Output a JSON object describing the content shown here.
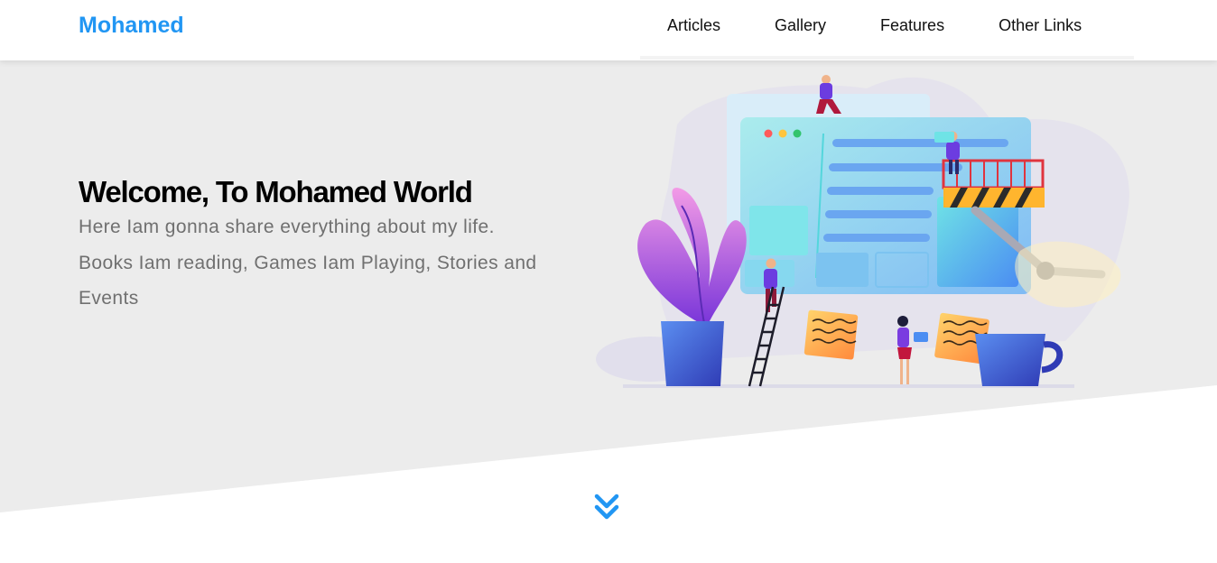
{
  "header": {
    "logo": "Mohamed",
    "nav": [
      {
        "label": "Articles"
      },
      {
        "label": "Gallery"
      },
      {
        "label": "Features"
      },
      {
        "label": "Other Links"
      }
    ]
  },
  "hero": {
    "title": "Welcome, To Mohamed World",
    "subtitle": "Here Iam gonna share everything about my life. Books Iam reading, Games Iam Playing, Stories and Events"
  },
  "colors": {
    "brand": "#2196f3",
    "hero_background": "#ececec",
    "subtitle_text": "#707070"
  },
  "icons": {
    "scroll_down": "chevrons-down-icon"
  }
}
